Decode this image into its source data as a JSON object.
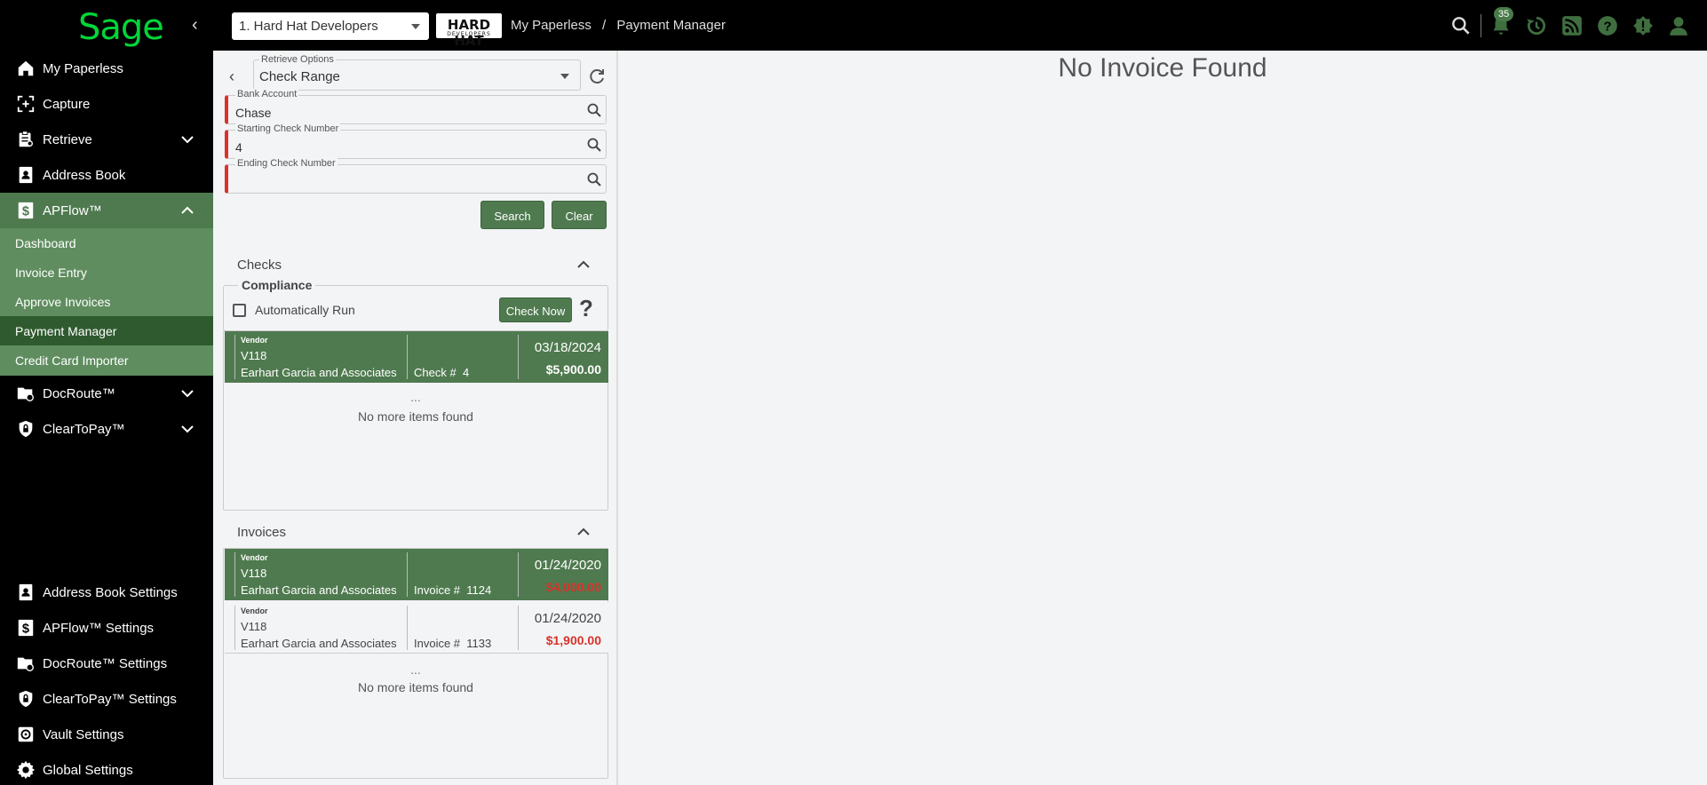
{
  "topbar": {
    "logo": "Sage",
    "company": "1. Hard Hat Developers",
    "brand_main": "HARD HAT",
    "brand_sub": "DEVELOPERS",
    "breadcrumb": [
      "My Paperless",
      "Payment Manager"
    ],
    "breadcrumb_sep": "/",
    "notification_count": "35",
    "accent_color": "#00d639"
  },
  "sidebar": {
    "items": [
      {
        "label": "My Paperless",
        "icon": "home-icon"
      },
      {
        "label": "Capture",
        "icon": "capture-icon"
      },
      {
        "label": "Retrieve",
        "icon": "retrieve-icon"
      },
      {
        "label": "Address Book",
        "icon": "address-book-icon"
      },
      {
        "label": "APFlow™",
        "icon": "dollar-icon"
      }
    ],
    "apflow_sub": [
      "Dashboard",
      "Invoice Entry",
      "Approve Invoices",
      "Payment Manager",
      "Credit Card Importer"
    ],
    "more_items": [
      {
        "label": "DocRoute™",
        "icon": "docroute-icon"
      },
      {
        "label": "ClearToPay™",
        "icon": "shield-icon"
      }
    ],
    "settings": [
      {
        "label": "Address Book Settings",
        "icon": "address-book-icon"
      },
      {
        "label": "APFlow™ Settings",
        "icon": "dollar-icon"
      },
      {
        "label": "DocRoute™ Settings",
        "icon": "docroute-icon"
      },
      {
        "label": "ClearToPay™ Settings",
        "icon": "shield-icon"
      },
      {
        "label": "Vault Settings",
        "icon": "vault-icon"
      },
      {
        "label": "Global Settings",
        "icon": "gear-icon"
      }
    ]
  },
  "filters": {
    "retrieve_label": "Retrieve Options",
    "retrieve_value": "Check Range",
    "bank_label": "Bank Account",
    "bank_value": "Chase",
    "start_label": "Starting Check Number",
    "start_value": "4",
    "end_label": "Ending Check Number",
    "end_value": "",
    "search_btn": "Search",
    "clear_btn": "Clear"
  },
  "checks": {
    "title": "Checks",
    "compliance_legend": "Compliance",
    "auto_run_label": "Automatically Run",
    "check_now_btn": "Check Now",
    "help": "?",
    "rows": [
      {
        "vendor_label": "Vendor",
        "vendor_code": "V118",
        "vendor_name": "Earhart Garcia and Associates",
        "doc_prefix": "Check #",
        "doc_no": "4",
        "date": "03/18/2024",
        "amount": "$5,900.00"
      }
    ],
    "dots": "...",
    "no_more": "No more items found"
  },
  "invoices": {
    "title": "Invoices",
    "rows": [
      {
        "vendor_label": "Vendor",
        "vendor_code": "V118",
        "vendor_name": "Earhart Garcia and Associates",
        "doc_prefix": "Invoice #",
        "doc_no": "1124",
        "date": "01/24/2020",
        "amount": "$4,000.00"
      },
      {
        "vendor_label": "Vendor",
        "vendor_code": "V118",
        "vendor_name": "Earhart Garcia and Associates",
        "doc_prefix": "Invoice #",
        "doc_no": "1133",
        "date": "01/24/2020",
        "amount": "$1,900.00"
      }
    ],
    "dots": "...",
    "no_more": "No more items found"
  },
  "main": {
    "message": "No Invoice Found"
  }
}
